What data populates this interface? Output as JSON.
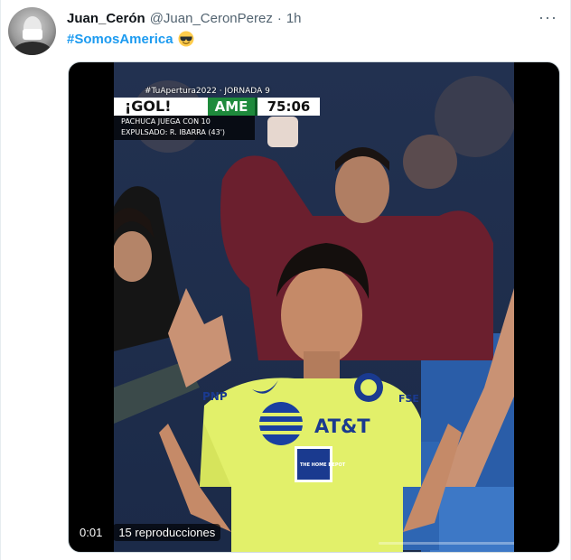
{
  "tweet": {
    "display_name": "Juan_Cerón",
    "handle": "@Juan_CeronPerez",
    "separator": "·",
    "time_ago": "1h",
    "hashtag": "#SomosAmerica",
    "emoji": "sunglasses-emoji",
    "more_icon": "···"
  },
  "video": {
    "scorebug": {
      "banner": "#TuApertura2022 · JORNADA 9",
      "event": "¡GOL!",
      "team": "AME",
      "clock": "75:06",
      "info_line_1": "PACHUCA JUEGA CON 10",
      "info_line_2": "EXPULSADO: R. IBARRA (43')"
    },
    "jersey_text": {
      "sponsor": "AT&T",
      "left_chest": "PNP",
      "sleeve": "FSE",
      "badge": "THE HOME DEPOT"
    },
    "elapsed": "0:01",
    "views": "15 reproducciones"
  },
  "colors": {
    "link": "#1d9bf0",
    "jersey": "#e2f06a",
    "scorebug_green": "#1e8a3c"
  }
}
